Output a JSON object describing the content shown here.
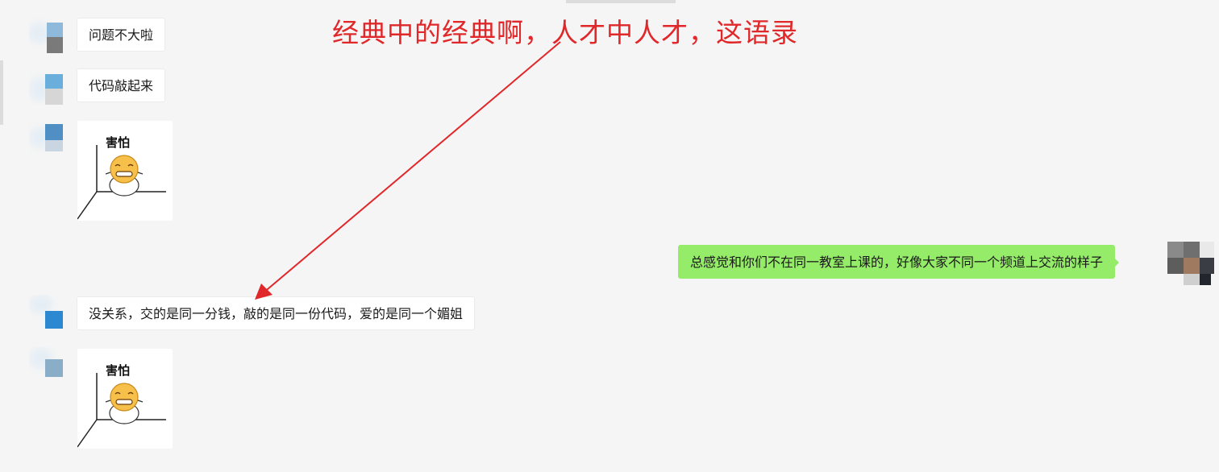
{
  "annotation": {
    "text": "经典中的经典啊，人才中人才，这语录",
    "color": "#e0282a"
  },
  "messages": [
    {
      "side": "left",
      "type": "text",
      "text": "问题不大啦"
    },
    {
      "side": "left",
      "type": "text",
      "text": "代码敲起来"
    },
    {
      "side": "left",
      "type": "sticker",
      "caption": "害怕"
    },
    {
      "side": "right",
      "type": "text",
      "text": "总感觉和你们不在同一教室上课的，好像大家不同一个频道上交流的样子"
    },
    {
      "side": "left",
      "type": "text",
      "text": "没关系，交的是同一分钱，敲的是同一份代码，爱的是同一个媚姐"
    },
    {
      "side": "left",
      "type": "sticker",
      "caption": "害怕"
    }
  ],
  "colors": {
    "background": "#f5f5f5",
    "incoming_bubble": "#ffffff",
    "outgoing_bubble": "#95ec69",
    "annotation": "#e0282a"
  }
}
